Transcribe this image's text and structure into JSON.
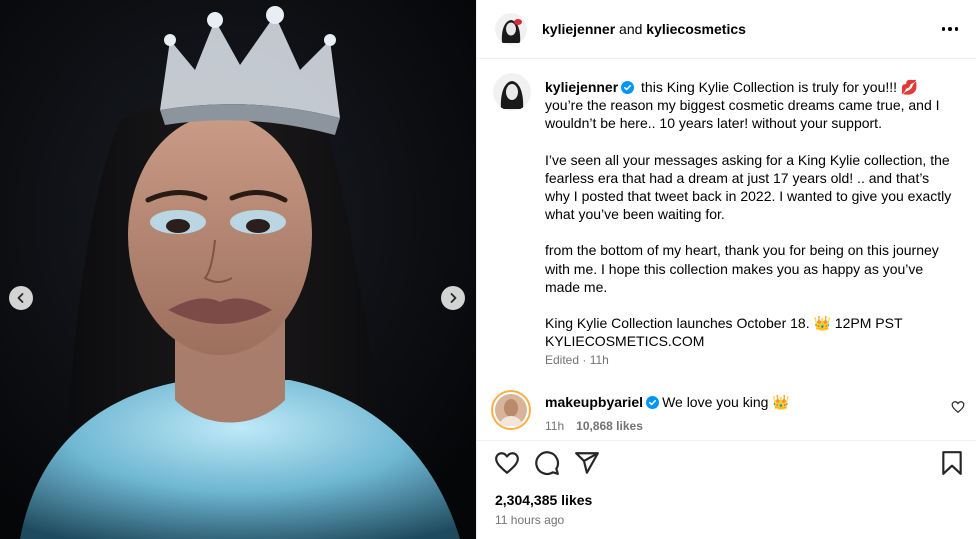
{
  "post": {
    "header": {
      "author": "kyliejenner",
      "joiner": "and",
      "collaborator": "kyliecosmetics",
      "more_icon": "more-horizontal-icon"
    },
    "caption": {
      "username": "kyliejenner",
      "paragraphs": [
        "this King Kylie Collection is truly for you!!! 💋 you’re the reason my biggest cosmetic dreams came true, and I wouldn’t be here.. 10 years later! without your support.",
        "I’ve seen all your messages asking for a King Kylie collection, the fearless era that had a dream at just 17 years old! .. and that’s why I posted that tweet back in 2022. I wanted to give you exactly what you’ve been waiting for.",
        "from the bottom of my heart, thank you for being on this journey with me. I hope this collection makes you as happy as you’ve made me.",
        "King Kylie Collection launches October 18. 👑 12PM PST KYLIECOSMETICS.COM"
      ],
      "edited": "Edited · 11h"
    },
    "comment": {
      "username": "makeupbyariel",
      "text": "We love you king 👑",
      "time": "11h",
      "likes": "10,868 likes"
    },
    "likes": "2,304,385 likes",
    "timestamp": "11 hours ago"
  },
  "colors": {
    "verified_blue": "#0095f6",
    "secondary_text": "#737373",
    "divider": "#efefef",
    "story_ring": "#fcaf45"
  }
}
